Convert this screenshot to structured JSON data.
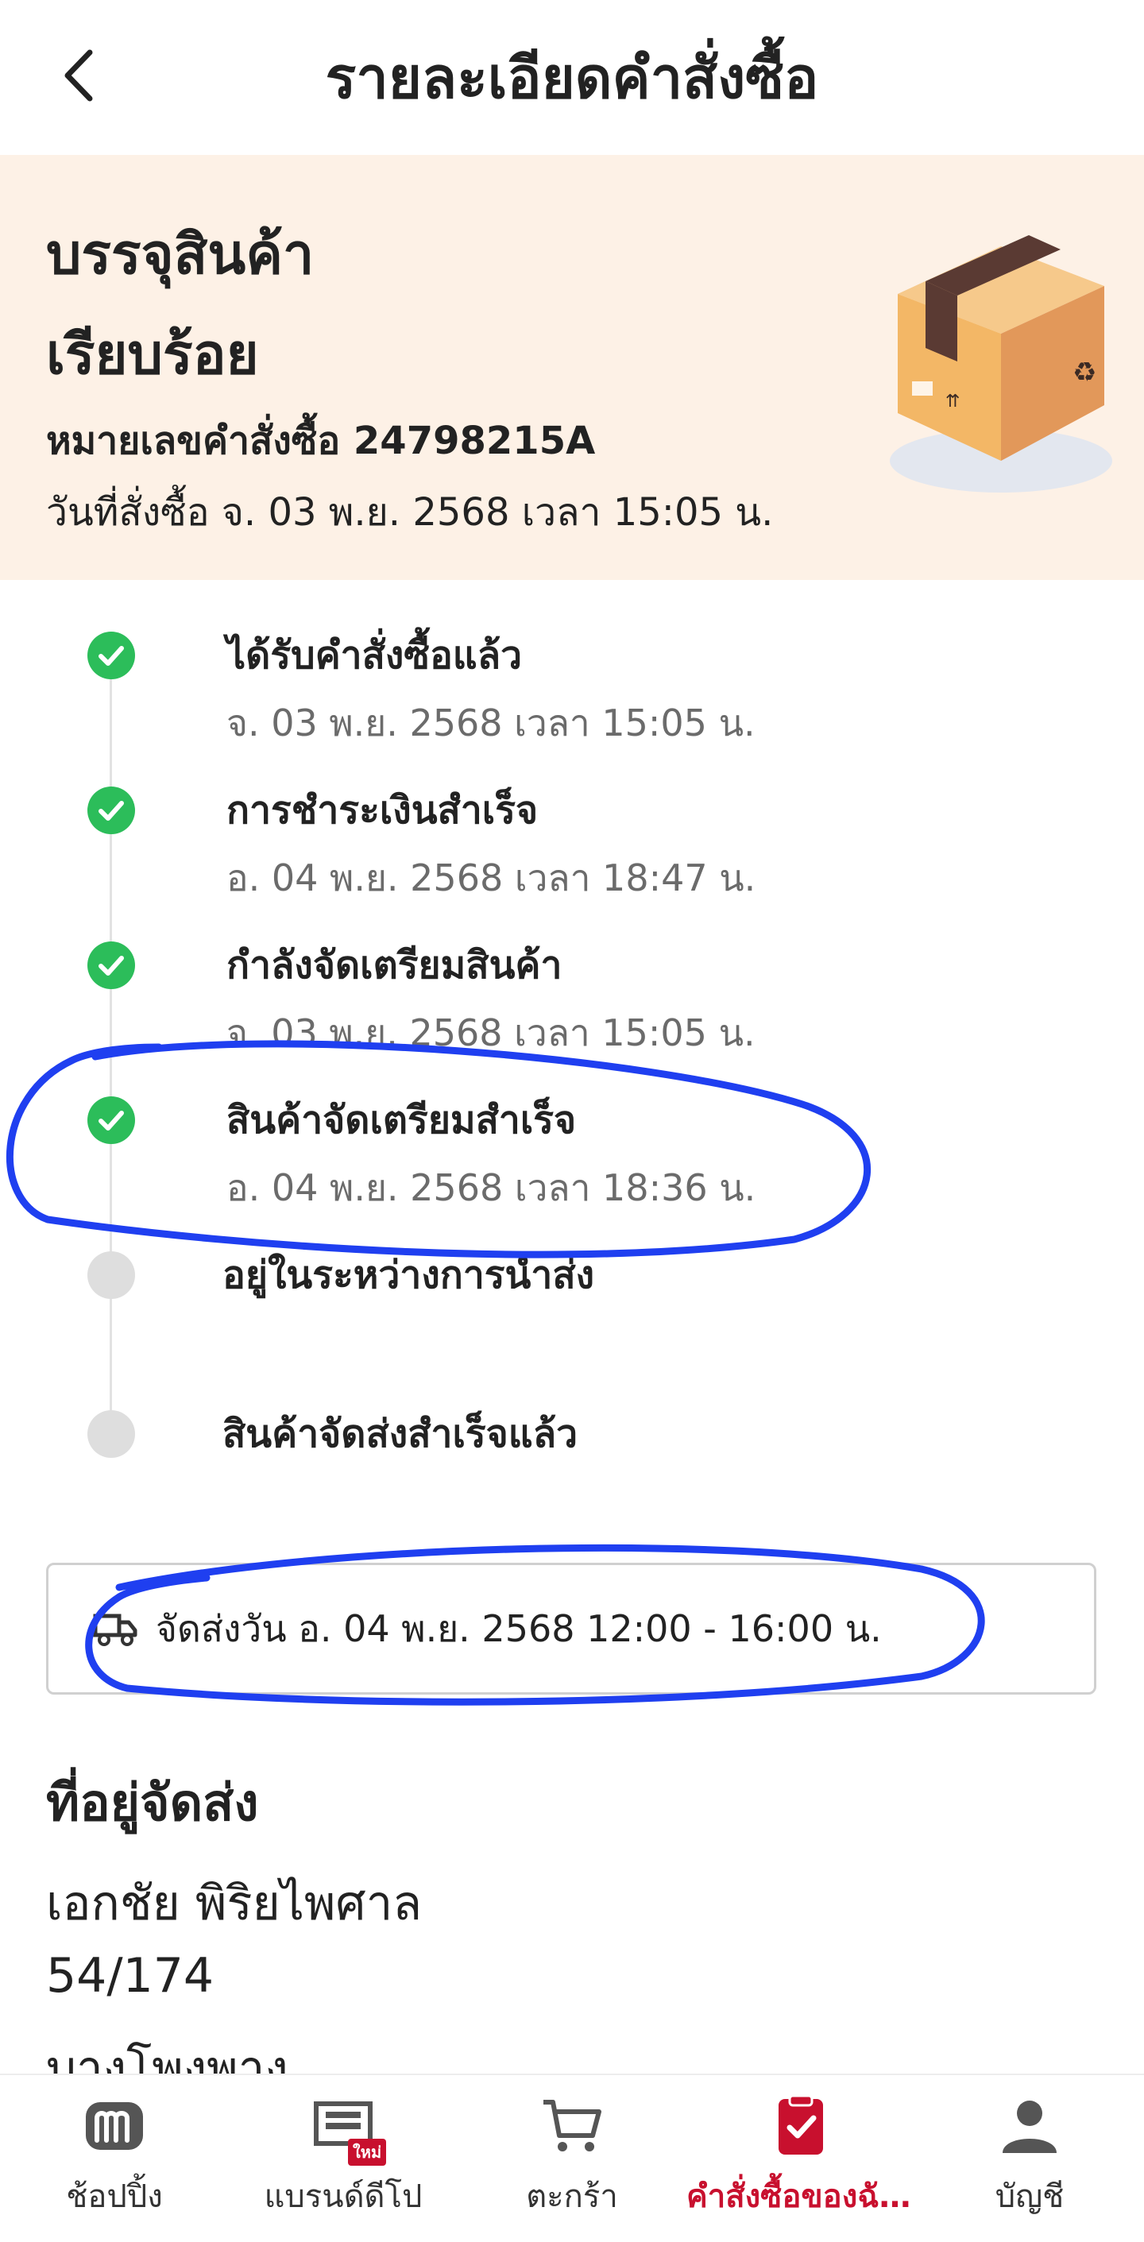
{
  "header": {
    "title": "รายละเอียดคำสั่งซื้อ"
  },
  "status": {
    "title_line1": "บรรจุสินค้า",
    "title_line2": "เรียบร้อย",
    "order_number": "หมายเลขคำสั่งซื้อ 24798215A",
    "order_date": "วันที่สั่งซื้อ จ. 03 พ.ย. 2568 เวลา 15:05 น."
  },
  "timeline": [
    {
      "label": "ได้รับคำสั่งซื้อแล้ว",
      "time": "จ. 03 พ.ย. 2568 เวลา 15:05 น.",
      "state": "done"
    },
    {
      "label": "การชำระเงินสำเร็จ",
      "time": "อ. 04 พ.ย. 2568 เวลา 18:47 น.",
      "state": "done"
    },
    {
      "label": "กำลังจัดเตรียมสินค้า",
      "time": "จ. 03 พ.ย. 2568 เวลา 15:05 น.",
      "state": "done"
    },
    {
      "label": "สินค้าจัดเตรียมสำเร็จ",
      "time": "อ. 04 พ.ย. 2568 เวลา 18:36 น.",
      "state": "done"
    },
    {
      "label": "อยู่ในระหว่างการนำส่ง",
      "time": "",
      "state": "pending"
    },
    {
      "label": "สินค้าจัดส่งสำเร็จแล้ว",
      "time": "",
      "state": "pending"
    }
  ],
  "delivery": {
    "text": "จัดส่งวัน อ. 04 พ.ย. 2568 12:00 - 16:00 น."
  },
  "address": {
    "heading": "ที่อยู่จัดส่ง",
    "name": "เอกชัย พิริยไพศาล",
    "line1": "54/174",
    "line2": "บางโพงพาง"
  },
  "nav": [
    {
      "label": "ช้อปปิ้ง",
      "icon": "shop-logo-icon",
      "active": false
    },
    {
      "label": "แบรนด์ดีโป",
      "icon": "brand-depot-icon",
      "badge": "ใหม่",
      "active": false
    },
    {
      "label": "ตะกร้า",
      "icon": "cart-icon",
      "active": false
    },
    {
      "label": "คำสั่งซื้อของฉั...",
      "icon": "orders-icon",
      "active": true
    },
    {
      "label": "บัญชี",
      "icon": "account-icon",
      "active": false
    }
  ],
  "colors": {
    "banner_bg": "#fdf1e6",
    "done": "#2cbd5a",
    "pending": "#dedede",
    "active_nav": "#c8102e",
    "annotation": "#1f3ff0"
  }
}
